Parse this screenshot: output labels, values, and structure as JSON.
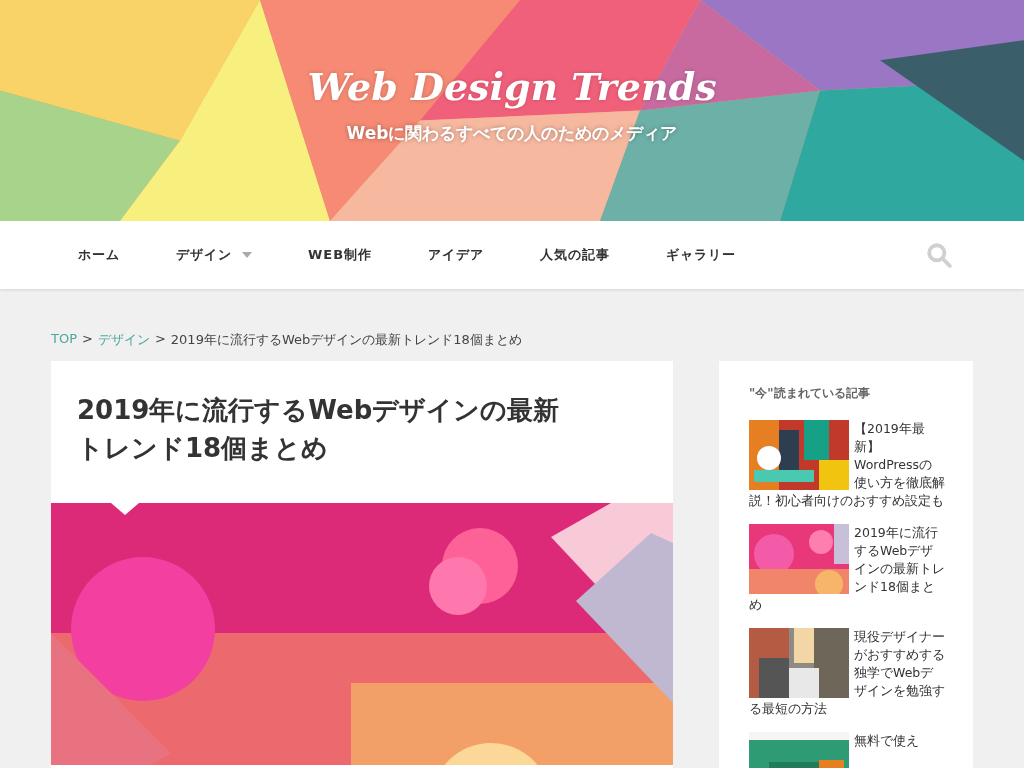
{
  "site": {
    "title": "Web Design Trends",
    "tagline": "Webに関わるすべての人のためのメディア"
  },
  "nav": {
    "items": [
      {
        "label": "ホーム",
        "dropdown": false
      },
      {
        "label": "デザイン",
        "dropdown": true
      },
      {
        "label": "WEB制作",
        "dropdown": false
      },
      {
        "label": "アイデア",
        "dropdown": false
      },
      {
        "label": "人気の記事",
        "dropdown": false
      },
      {
        "label": "ギャラリー",
        "dropdown": false
      }
    ]
  },
  "breadcrumb": {
    "links": [
      "TOP",
      "デザイン"
    ],
    "separator": ">",
    "current": "2019年に流行するWebデザインの最新トレンド18個まとめ"
  },
  "article": {
    "title": "2019年に流行するWebデザインの最新トレンド18個まとめ"
  },
  "sidebar": {
    "heading": "\"今\"読まれている記事",
    "posts": [
      {
        "title": "【2019年最新】WordPressの使い方を徹底解説！初心者向けのおすすめ設定も"
      },
      {
        "title": "2019年に流行するWebデザインの最新トレンド18個まとめ"
      },
      {
        "title": "現役デザイナーがおすすめする独学でWebデザインを勉強する最短の方法"
      },
      {
        "title": "無料で使え"
      }
    ]
  }
}
